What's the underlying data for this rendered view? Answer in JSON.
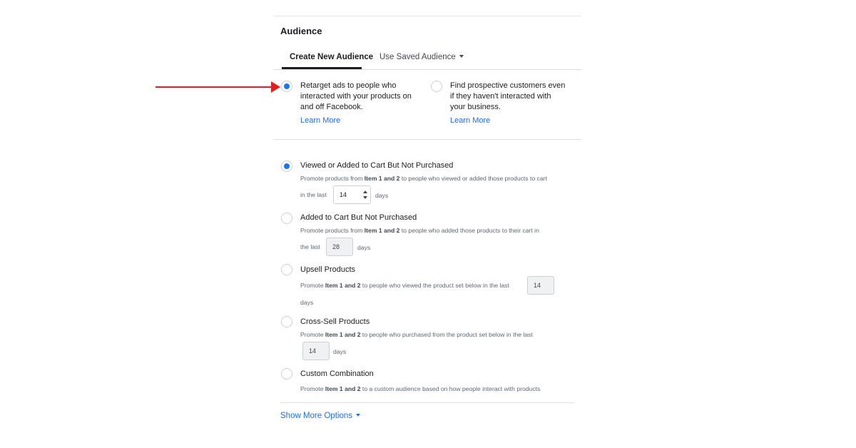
{
  "audience": {
    "title": "Audience",
    "tabs": [
      {
        "label": "Create New Audience",
        "active": true
      },
      {
        "label": "Use Saved Audience",
        "active": false
      }
    ],
    "choices": [
      {
        "line1": "Retarget ads to people who",
        "line2": "interacted with your products on",
        "line3": "and off Facebook.",
        "link": "Learn More",
        "checked": true
      },
      {
        "line1": "Find prospective customers even",
        "line2": "if they haven't interacted with",
        "line3": "your business.",
        "link": "Learn More",
        "checked": false
      }
    ]
  },
  "options": [
    {
      "title": "Viewed or Added to Cart But Not Purchased",
      "desc_pre": "Promote products from ",
      "desc_bold": "Item 1 and 2",
      "desc_post": " to people who viewed or added those products to cart",
      "in_the_last": "in the last",
      "days_value": "14",
      "days_label": "days",
      "checked": true
    },
    {
      "title": "Added to Cart But Not Purchased",
      "desc_pre": "Promote products from ",
      "desc_bold": "Item 1 and 2",
      "desc_post": " to people who added those products to their cart in",
      "in_the_last": "the last",
      "days_value": "28",
      "days_label": "days",
      "checked": false
    },
    {
      "title": "Upsell Products",
      "desc_pre": "Promote ",
      "desc_bold": "Item 1 and 2",
      "desc_post": " to people who viewed the product set below in the last",
      "days_value": "14",
      "days_label": "days",
      "checked": false
    },
    {
      "title": "Cross-Sell Products",
      "desc_pre": "Promote ",
      "desc_bold": "Item 1 and 2",
      "desc_post": " to people who purchased from the product set below in the last",
      "days_value": "14",
      "days_label": "days",
      "checked": false
    },
    {
      "title": "Custom Combination",
      "desc_pre": "Promote ",
      "desc_bold": "Item 1 and 2",
      "desc_post": " to a custom audience based on how people interact with products",
      "checked": false
    }
  ],
  "show_more": "Show More Options",
  "colors": {
    "accent": "#1877f2",
    "link": "#216fdb",
    "annotation_arrow": "#e02020"
  },
  "icons": [
    "caret-down-icon",
    "spinner-up-icon",
    "spinner-down-icon",
    "red-arrow-icon"
  ]
}
